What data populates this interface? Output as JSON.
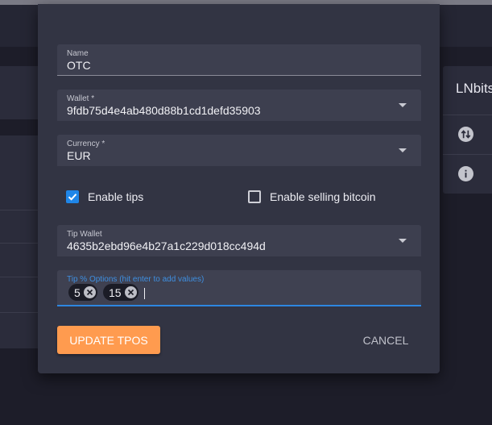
{
  "background": {
    "right_card_title": "LNbits",
    "icons": [
      "swap-vertical-icon",
      "info-icon"
    ]
  },
  "dialog": {
    "name_field": {
      "label": "Name",
      "value": "OTC"
    },
    "wallet_field": {
      "label": "Wallet *",
      "value": "9fdb75d4e4ab480d88b1cd1defd35903"
    },
    "currency_field": {
      "label": "Currency *",
      "value": "EUR"
    },
    "enable_tips": {
      "label": "Enable tips",
      "checked": true
    },
    "enable_selling": {
      "label": "Enable selling bitcoin",
      "checked": false
    },
    "tip_wallet_field": {
      "label": "Tip Wallet",
      "value": "4635b2ebd96e4b27a1c229d018cc494d"
    },
    "tip_options_field": {
      "label": "Tip % Options (hit enter to add values)",
      "chips": [
        "5",
        "15"
      ]
    },
    "update_button": "UPDATE TPOS",
    "cancel_button": "CANCEL"
  },
  "colors": {
    "accent": "#ff9b4f",
    "primary": "#1f86e8",
    "dialog_bg": "#323443"
  }
}
